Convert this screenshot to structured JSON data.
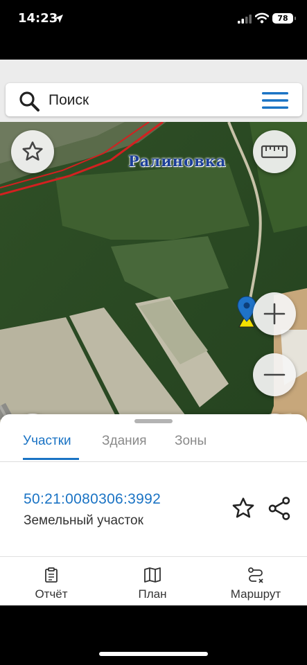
{
  "status": {
    "time": "14:23",
    "battery": "78"
  },
  "search": {
    "placeholder": "Поиск"
  },
  "map": {
    "village_label": "Ралиновка"
  },
  "sheet": {
    "tabs": [
      {
        "label": "Участки",
        "active": true
      },
      {
        "label": "Здания",
        "active": false
      },
      {
        "label": "Зоны",
        "active": false
      }
    ],
    "parcel": {
      "id": "50:21:0080306:3992",
      "type": "Земельный участок"
    }
  },
  "bottom_nav": [
    {
      "label": "Отчёт",
      "icon": "report-icon"
    },
    {
      "label": "План",
      "icon": "map-icon"
    },
    {
      "label": "Маршрут",
      "icon": "route-icon"
    }
  ],
  "colors": {
    "accent": "#1a73c4",
    "boundary": "#d32020"
  }
}
